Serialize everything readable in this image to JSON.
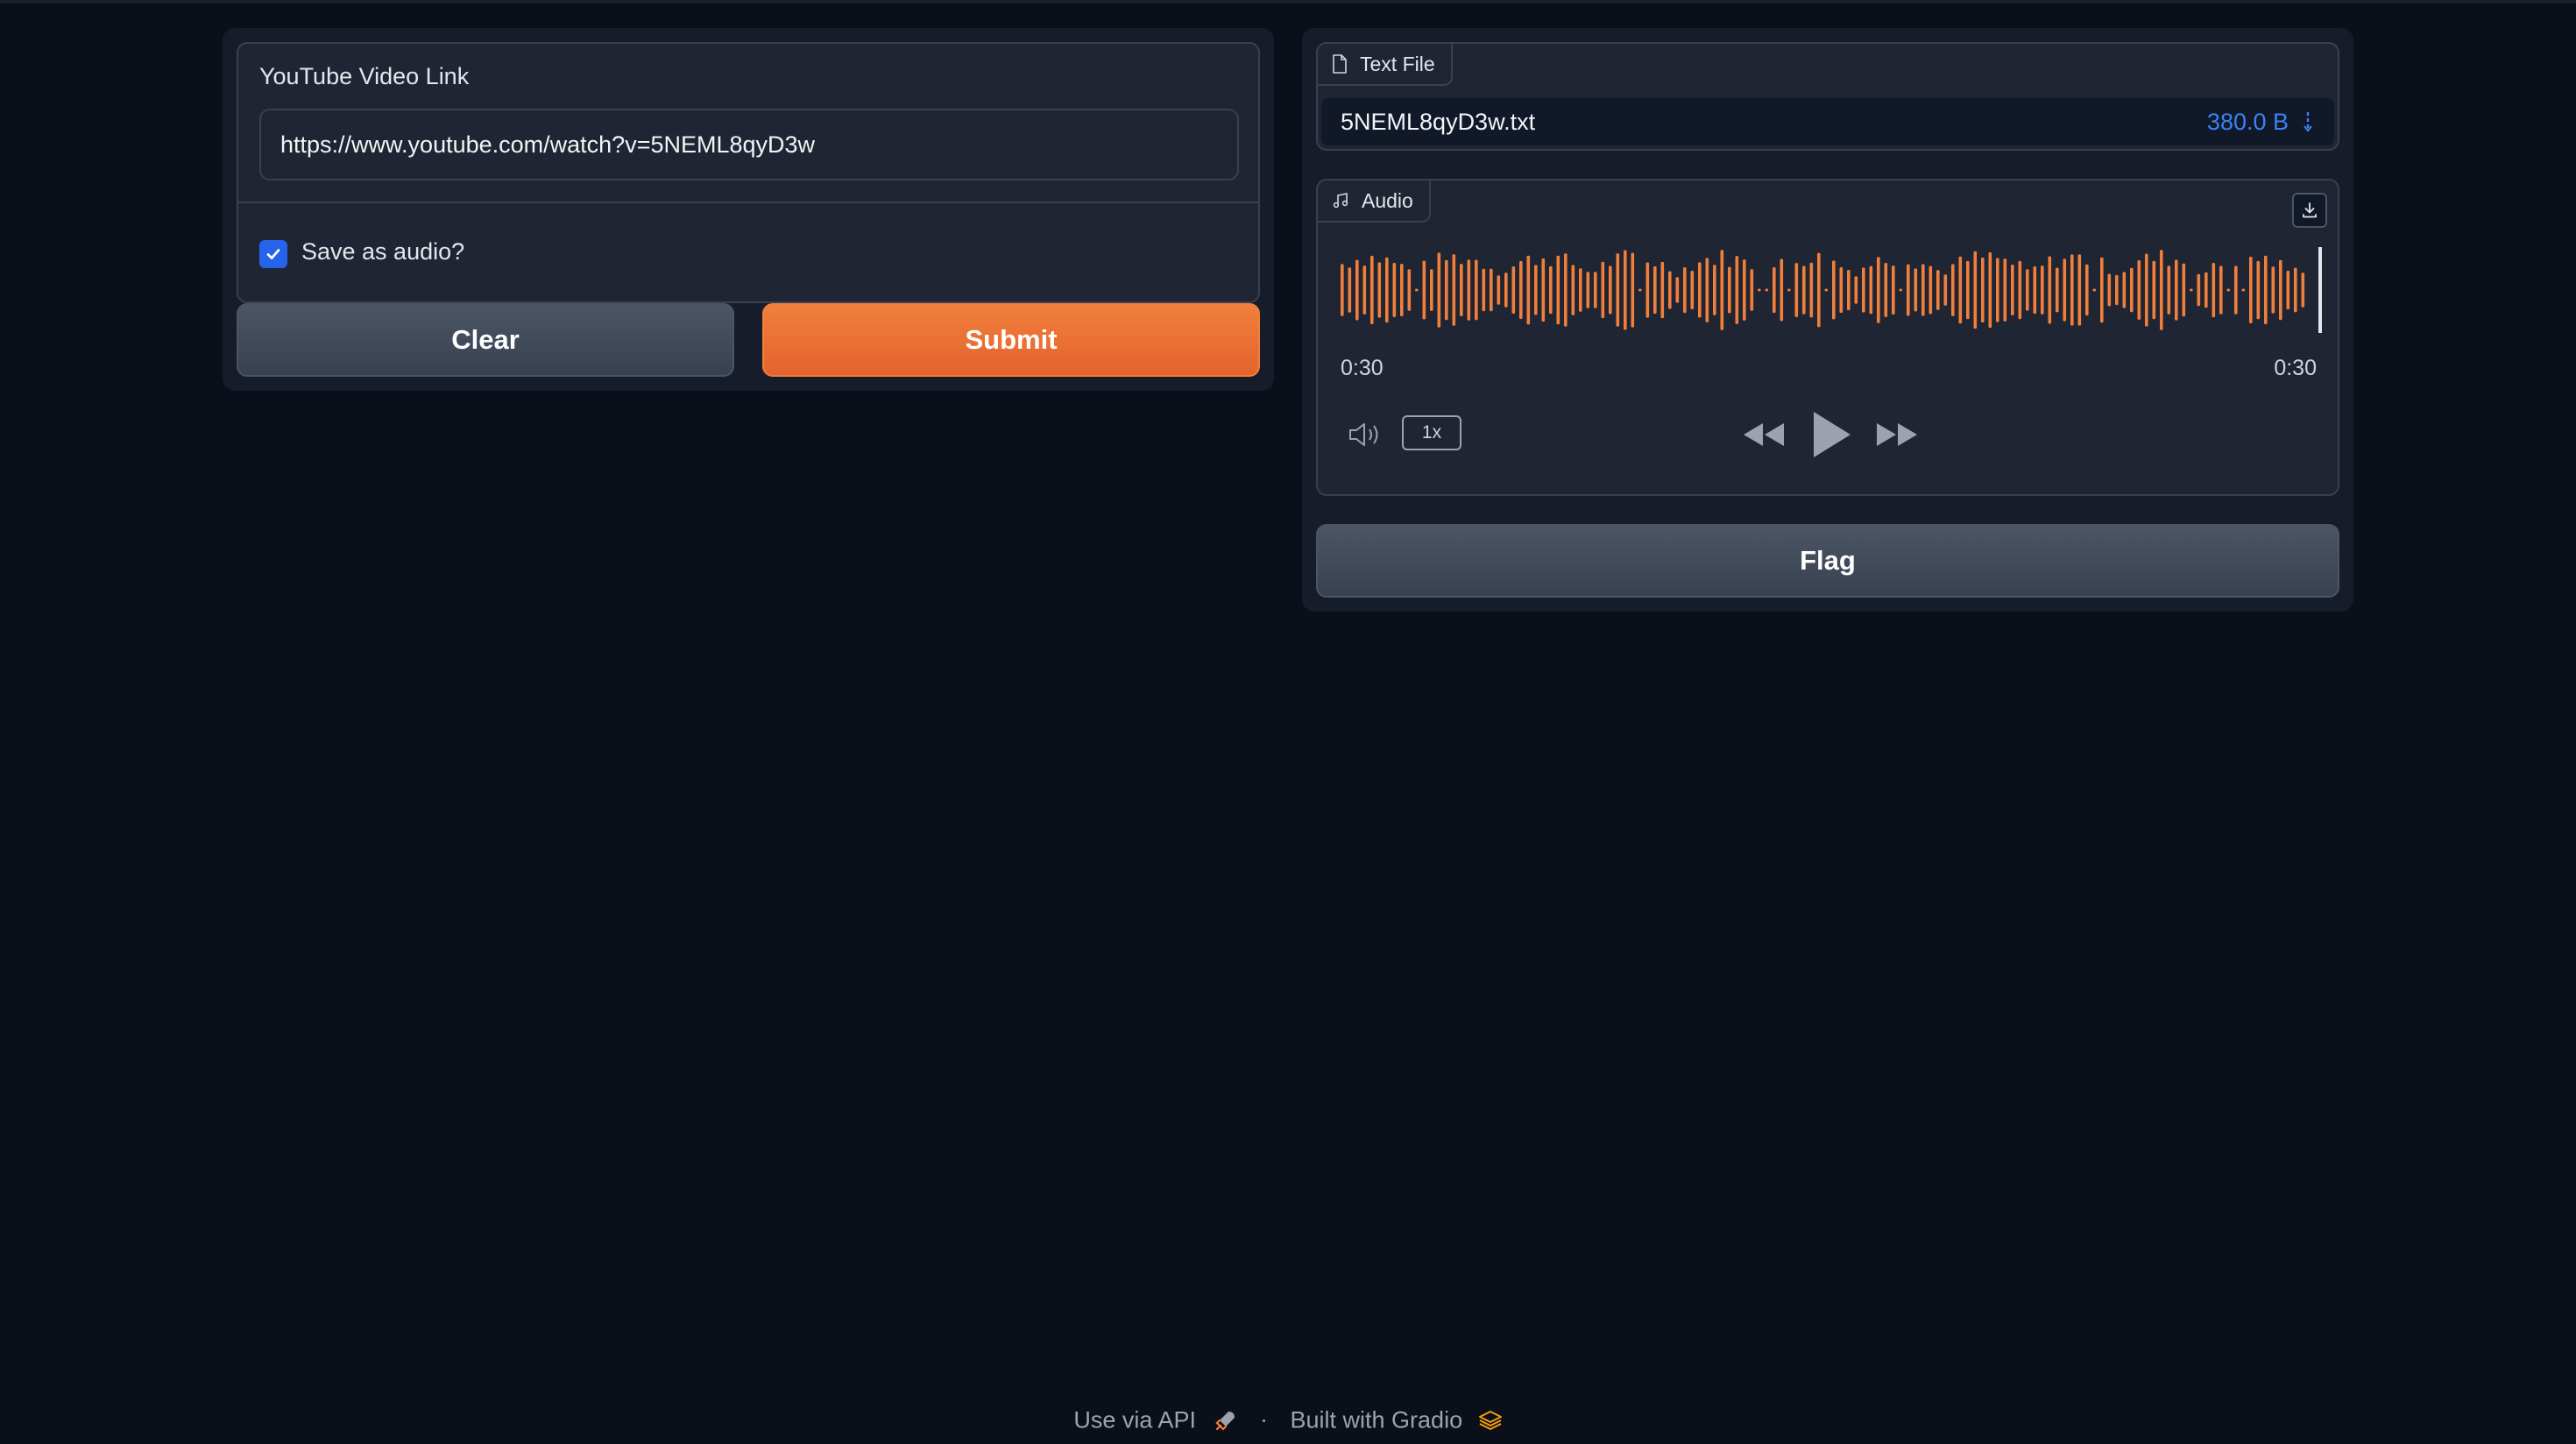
{
  "input_panel": {
    "url_label": "YouTube Video Link",
    "url_value": "https://www.youtube.com/watch?v=5NEML8qyD3w",
    "checkbox_label": "Save as audio?",
    "checkbox_checked": true
  },
  "buttons": {
    "clear_label": "Clear",
    "submit_label": "Submit",
    "flag_label": "Flag"
  },
  "output_file": {
    "tab_label": "Text File",
    "file_name": "5NEML8qyD3w.txt",
    "file_size": "380.0 B"
  },
  "output_audio": {
    "tab_label": "Audio",
    "time_current": "0:30",
    "time_total": "0:30",
    "playback_rate": "1x",
    "playback_progress": 1.0
  },
  "footer": {
    "api_link": "Use via API",
    "separator": "·",
    "built_with": "Built with Gradio"
  },
  "colors": {
    "background": "#0b0f19",
    "accent": "#e4632d",
    "waveform": "#f07f3c",
    "checkbox": "#2563eb",
    "file_size": "#3b82f6"
  }
}
